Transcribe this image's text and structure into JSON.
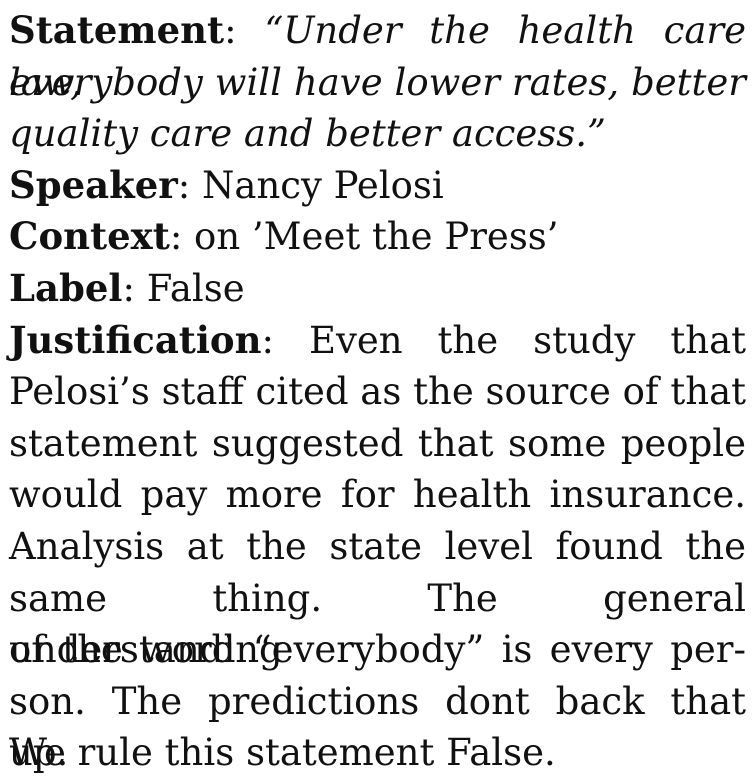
{
  "statement": {
    "label": "Statement",
    "separator": ":",
    "text_lines": [
      "“Under the health care law,",
      "everybody will have lower rates, better",
      "quality care and better access.”"
    ]
  },
  "speaker": {
    "label": "Speaker",
    "separator": ":",
    "value": "Nancy Pelosi"
  },
  "context": {
    "label": "Context",
    "separator": ":",
    "value": "on ’Meet the Press’"
  },
  "label_field": {
    "label": "Label",
    "separator": ":",
    "value": "False"
  },
  "justification": {
    "label": "Justification",
    "separator": ":",
    "text_lines": [
      "Even the study that",
      "Pelosi’s staff cited as the source of that",
      "statement suggested that some people",
      "would pay more for health insurance.",
      "Analysis at the state level found the",
      "same thing. The general understanding",
      "of the word “everybody” is every per-",
      "son. The predictions dont back that up.",
      "We rule this statement False."
    ]
  }
}
